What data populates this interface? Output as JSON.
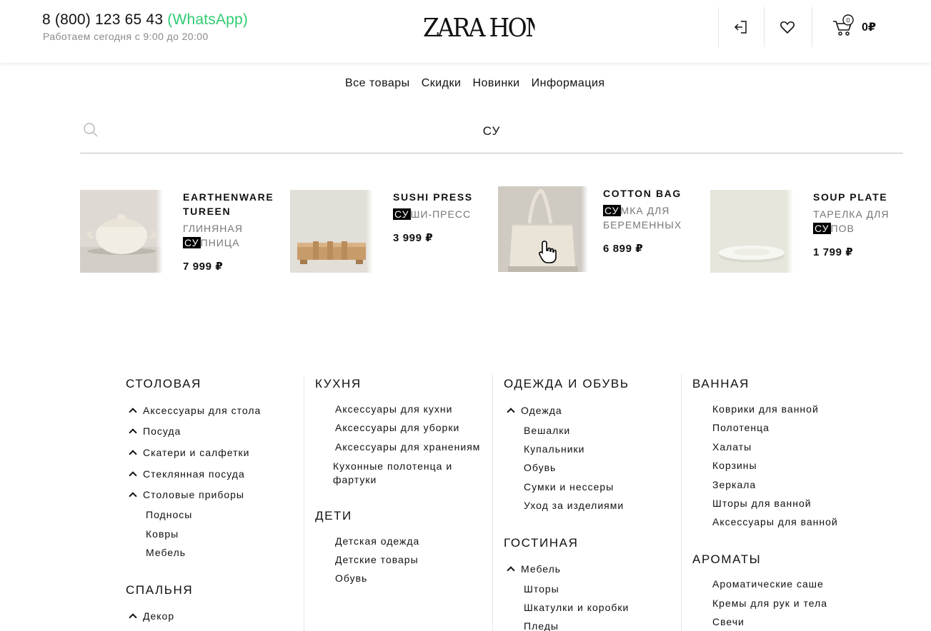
{
  "header": {
    "phone": "8 (800) 123 65 43",
    "whatsapp": "(WhatsApp)",
    "hours": "Работаем сегодня с 9:00 до 20:00",
    "logo": "ZARA HOME",
    "cart_total": "0₽",
    "icons": [
      "login-icon",
      "heart-icon",
      "cart-icon"
    ],
    "cart_count": "0"
  },
  "nav": [
    "Все товары",
    "Скидки",
    "Новинки",
    "Информация"
  ],
  "search": {
    "query": "СУ"
  },
  "products": [
    {
      "title": "EARTHENWARE TUREEN",
      "desc_before": "ГЛИНЯНАЯ ",
      "desc_hl": "СУ",
      "desc_after": "ПНИЦА",
      "price": "7 999 ₽"
    },
    {
      "title": "SUSHI PRESS",
      "desc_before": "",
      "desc_hl": "СУ",
      "desc_after": "ШИ-ПРЕСС",
      "price": "3 999 ₽"
    },
    {
      "title": "COTTON BAG",
      "desc_before": "",
      "desc_hl": "СУ",
      "desc_after": "МКА ДЛЯ БЕРЕМЕННЫХ",
      "price": "6 899 ₽"
    },
    {
      "title": "SOUP PLATE",
      "desc_before": "ТАРЕЛКА ДЛЯ ",
      "desc_hl": "СУ",
      "desc_after": "ПОВ",
      "price": "1 799 ₽"
    }
  ],
  "catalog": {
    "col1": {
      "title1": "Столовая",
      "items1": [
        "Аксессуары для стола",
        "Посуда",
        "Скатери и салфетки",
        "Стеклянная посуда",
        "Столовые приборы"
      ],
      "sub1": [
        "Подносы",
        "Ковры",
        "Мебель"
      ],
      "title2": "Спальня",
      "items2": [
        "Декор"
      ]
    },
    "col2": {
      "title1": "Кухня",
      "items1": [
        "Аксессуары для кухни",
        "Аксессуары для уборки",
        "Аксессуары для хранениям",
        "Кухонные полотенца и фартуки"
      ],
      "title2": "Дети",
      "items2": [
        "Детская одежда",
        "Детские товары",
        "Обувь"
      ]
    },
    "col3": {
      "title1": "Одежда и обувь",
      "items1": [
        "Одежда"
      ],
      "sub1": [
        "Вешалки",
        "Купальники",
        "Обувь",
        "Сумки и нессеры",
        "Уход за изделиями"
      ],
      "title2": "Гостиная",
      "items2": [
        "Мебель"
      ],
      "sub2": [
        "Шторы",
        "Шкатулки и коробки",
        "Пледы"
      ]
    },
    "col4": {
      "title1": "Ванная",
      "items1": [
        "Коврики для ванной",
        "Полотенца",
        "Халаты",
        "Корзины",
        "Зеркала",
        "Шторы для ванной",
        "Аксессуары для ванной"
      ],
      "title2": "Ароматы",
      "items2": [
        "Ароматические саше",
        "Кремы для рук и тела",
        "Свечи"
      ]
    }
  },
  "colors": {
    "whatsapp": "#2ecc71",
    "highlight": "#000000"
  }
}
